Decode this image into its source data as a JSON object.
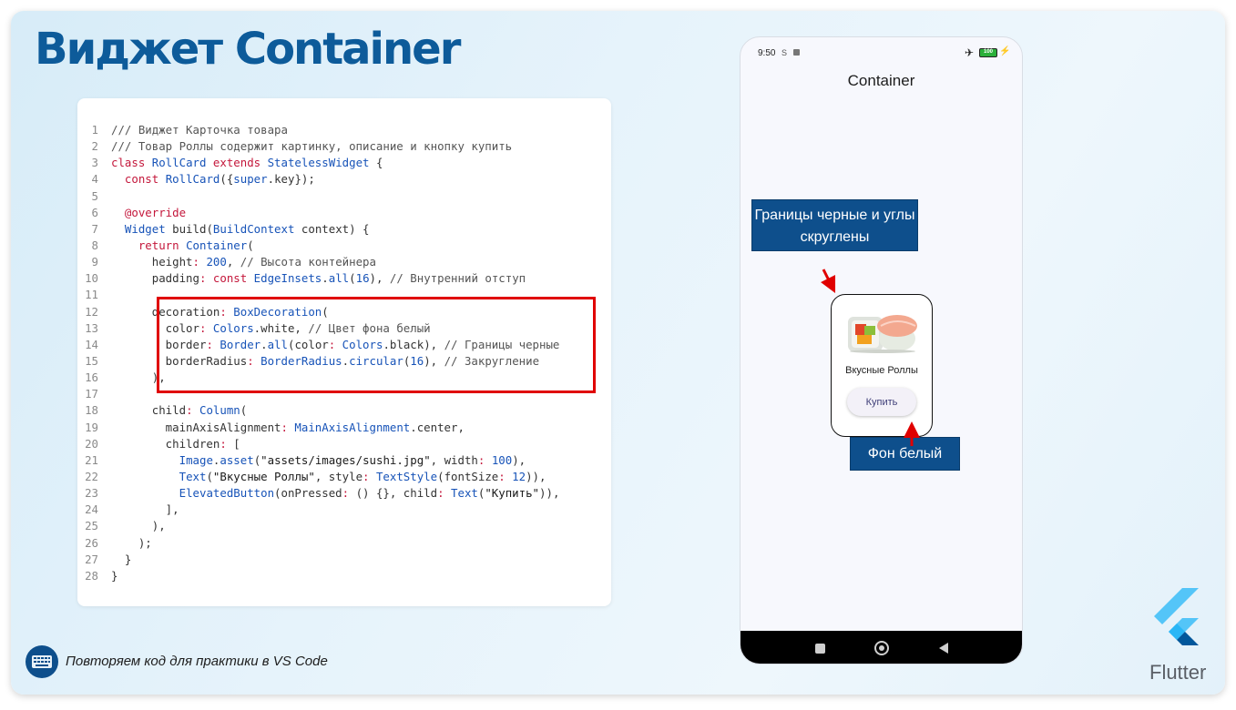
{
  "slide": {
    "title": "Виджет Container",
    "footer_text": "Повторяем код для практики в VS Code",
    "brand_label": "Flutter"
  },
  "code": {
    "lines": [
      {
        "n": "1",
        "t": [
          [
            "cm",
            "/// Виджет Карточка товара"
          ]
        ]
      },
      {
        "n": "2",
        "t": [
          [
            "cm",
            "/// Товар Роллы содержит картинку, описание и кнопку купить"
          ]
        ]
      },
      {
        "n": "3",
        "t": [
          [
            "kw",
            "class "
          ],
          [
            "ty",
            "RollCard "
          ],
          [
            "kw",
            "extends "
          ],
          [
            "ty",
            "StatelessWidget"
          ],
          [
            "",
            " {"
          ]
        ]
      },
      {
        "n": "4",
        "t": [
          [
            "",
            "  "
          ],
          [
            "kw",
            "const "
          ],
          [
            "ty",
            "RollCard"
          ],
          [
            "",
            "({"
          ],
          [
            "ty",
            "super"
          ],
          [
            "",
            ".key});"
          ]
        ]
      },
      {
        "n": "5",
        "t": []
      },
      {
        "n": "6",
        "t": [
          [
            "",
            "  "
          ],
          [
            "kw",
            "@override"
          ]
        ]
      },
      {
        "n": "7",
        "t": [
          [
            "",
            "  "
          ],
          [
            "ty",
            "Widget "
          ],
          [
            "",
            "build("
          ],
          [
            "ty",
            "BuildContext"
          ],
          [
            "",
            " context) {"
          ]
        ]
      },
      {
        "n": "8",
        "t": [
          [
            "",
            "    "
          ],
          [
            "kw",
            "return "
          ],
          [
            "ty",
            "Container"
          ],
          [
            "",
            "("
          ]
        ]
      },
      {
        "n": "9",
        "t": [
          [
            "",
            "      height"
          ],
          [
            "kw",
            ": "
          ],
          [
            "nu",
            "200"
          ],
          [
            "",
            ", "
          ],
          [
            "cm",
            "// Высота контейнера"
          ]
        ]
      },
      {
        "n": "10",
        "t": [
          [
            "",
            "      padding"
          ],
          [
            "kw",
            ": const "
          ],
          [
            "ty",
            "EdgeInsets"
          ],
          [
            "",
            "."
          ],
          [
            "ty",
            "all"
          ],
          [
            "",
            "("
          ],
          [
            "nu",
            "16"
          ],
          [
            "",
            "), "
          ],
          [
            "cm",
            "// Внутренний отступ"
          ]
        ]
      },
      {
        "n": "11",
        "t": []
      },
      {
        "n": "12",
        "t": [
          [
            "",
            "      decoration"
          ],
          [
            "kw",
            ": "
          ],
          [
            "ty",
            "BoxDecoration"
          ],
          [
            "",
            "("
          ]
        ]
      },
      {
        "n": "13",
        "t": [
          [
            "",
            "        color"
          ],
          [
            "kw",
            ": "
          ],
          [
            "ty",
            "Colors"
          ],
          [
            "",
            ".white, "
          ],
          [
            "cm",
            "// Цвет фона белый"
          ]
        ]
      },
      {
        "n": "14",
        "t": [
          [
            "",
            "        border"
          ],
          [
            "kw",
            ": "
          ],
          [
            "ty",
            "Border"
          ],
          [
            "",
            "."
          ],
          [
            "ty",
            "all"
          ],
          [
            "",
            "(color"
          ],
          [
            "kw",
            ": "
          ],
          [
            "ty",
            "Colors"
          ],
          [
            "",
            ".black), "
          ],
          [
            "cm",
            "// Границы черные"
          ]
        ]
      },
      {
        "n": "15",
        "t": [
          [
            "",
            "        borderRadius"
          ],
          [
            "kw",
            ": "
          ],
          [
            "ty",
            "BorderRadius"
          ],
          [
            "",
            "."
          ],
          [
            "ty",
            "circular"
          ],
          [
            "",
            "("
          ],
          [
            "nu",
            "16"
          ],
          [
            "",
            "), "
          ],
          [
            "cm",
            "// Закругление"
          ]
        ]
      },
      {
        "n": "16",
        "t": [
          [
            "",
            "      ),"
          ]
        ]
      },
      {
        "n": "17",
        "t": []
      },
      {
        "n": "18",
        "t": [
          [
            "",
            "      child"
          ],
          [
            "kw",
            ": "
          ],
          [
            "ty",
            "Column"
          ],
          [
            "",
            "("
          ]
        ]
      },
      {
        "n": "19",
        "t": [
          [
            "",
            "        mainAxisAlignment"
          ],
          [
            "kw",
            ": "
          ],
          [
            "ty",
            "MainAxisAlignment"
          ],
          [
            "",
            ".center,"
          ]
        ]
      },
      {
        "n": "20",
        "t": [
          [
            "",
            "        children"
          ],
          [
            "kw",
            ": "
          ],
          [
            "",
            "["
          ]
        ]
      },
      {
        "n": "21",
        "t": [
          [
            "",
            "          "
          ],
          [
            "ty",
            "Image"
          ],
          [
            "",
            "."
          ],
          [
            "ty",
            "asset"
          ],
          [
            "",
            "("
          ],
          [
            "st",
            "\"assets/images/sushi.jpg\""
          ],
          [
            "",
            ", width"
          ],
          [
            "kw",
            ": "
          ],
          [
            "nu",
            "100"
          ],
          [
            "",
            "),"
          ]
        ]
      },
      {
        "n": "22",
        "t": [
          [
            "",
            "          "
          ],
          [
            "ty",
            "Text"
          ],
          [
            "",
            "("
          ],
          [
            "st",
            "\"Вкусные Роллы\""
          ],
          [
            "",
            ", style"
          ],
          [
            "kw",
            ": "
          ],
          [
            "ty",
            "TextStyle"
          ],
          [
            "",
            "(fontSize"
          ],
          [
            "kw",
            ": "
          ],
          [
            "nu",
            "12"
          ],
          [
            "",
            ")),"
          ]
        ]
      },
      {
        "n": "23",
        "t": [
          [
            "",
            "          "
          ],
          [
            "ty",
            "ElevatedButton"
          ],
          [
            "",
            "(onPressed"
          ],
          [
            "kw",
            ": "
          ],
          [
            "",
            "() {}, child"
          ],
          [
            "kw",
            ": "
          ],
          [
            "ty",
            "Text"
          ],
          [
            "",
            "("
          ],
          [
            "st",
            "\"Купить\""
          ],
          [
            "",
            ")),"
          ]
        ]
      },
      {
        "n": "24",
        "t": [
          [
            "",
            "        ],"
          ]
        ]
      },
      {
        "n": "25",
        "t": [
          [
            "",
            "      ),"
          ]
        ]
      },
      {
        "n": "26",
        "t": [
          [
            "",
            "    );"
          ]
        ]
      },
      {
        "n": "27",
        "t": [
          [
            "",
            "  }"
          ]
        ]
      },
      {
        "n": "28",
        "t": [
          [
            "",
            "}"
          ]
        ]
      }
    ]
  },
  "phone": {
    "status_time": "9:50",
    "status_icon_a": "S",
    "battery": "100",
    "app_title": "Container",
    "card_text": "Вкусные Роллы",
    "buy_label": "Купить"
  },
  "callouts": {
    "borders": "Границы черные и углы скруглены",
    "background": "Фон белый"
  },
  "colors": {
    "title": "#0d5b9a",
    "highlight": "#e00000",
    "callout": "#0e4f8c",
    "keyword": "#c4173b",
    "type": "#1753b8"
  },
  "icons": [
    "keyboard-icon",
    "flutter-logo-icon",
    "airplane-icon",
    "battery-icon",
    "nav-square-icon",
    "nav-home-icon",
    "nav-back-icon"
  ]
}
